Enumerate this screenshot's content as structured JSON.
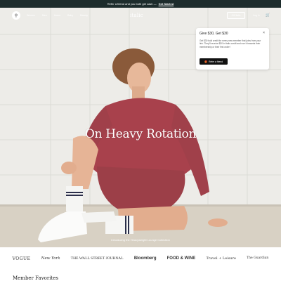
{
  "announcement": {
    "text": "Refer a friend and you both get cash —",
    "cta": "Get Started"
  },
  "header": {
    "logo": "italic",
    "nav": [
      "Women",
      "Men",
      "Home",
      "Baby",
      "Beauty"
    ],
    "gift_button": "Gift Italic",
    "login": "Log In"
  },
  "hero": {
    "title": "On Heavy Rotation",
    "subtitle": "Introducing the Heavyweight Lounge Collection"
  },
  "popup": {
    "title": "Give $30, Get $30",
    "body": "Get $30 bulk credit for every new member that joins from your link. They'll receive $30 in Italic credit and use it towards their membership or their first order!",
    "button": "Refer a friend",
    "close": "×"
  },
  "press": [
    "VOGUE",
    "New York",
    "THE WALL STREET JOURNAL",
    "Bloomberg",
    "FOOD & WINE",
    "Travel + Leisure",
    "The Guardian"
  ],
  "section": {
    "title": "Member Favorites"
  },
  "colors": {
    "announce_bg": "#1d2c2c",
    "sweat": "#a8414c",
    "accent": "#111111"
  },
  "icons": {
    "search": "search-icon",
    "cart": "cart-icon",
    "close": "close-icon",
    "gift": "gift-icon"
  }
}
